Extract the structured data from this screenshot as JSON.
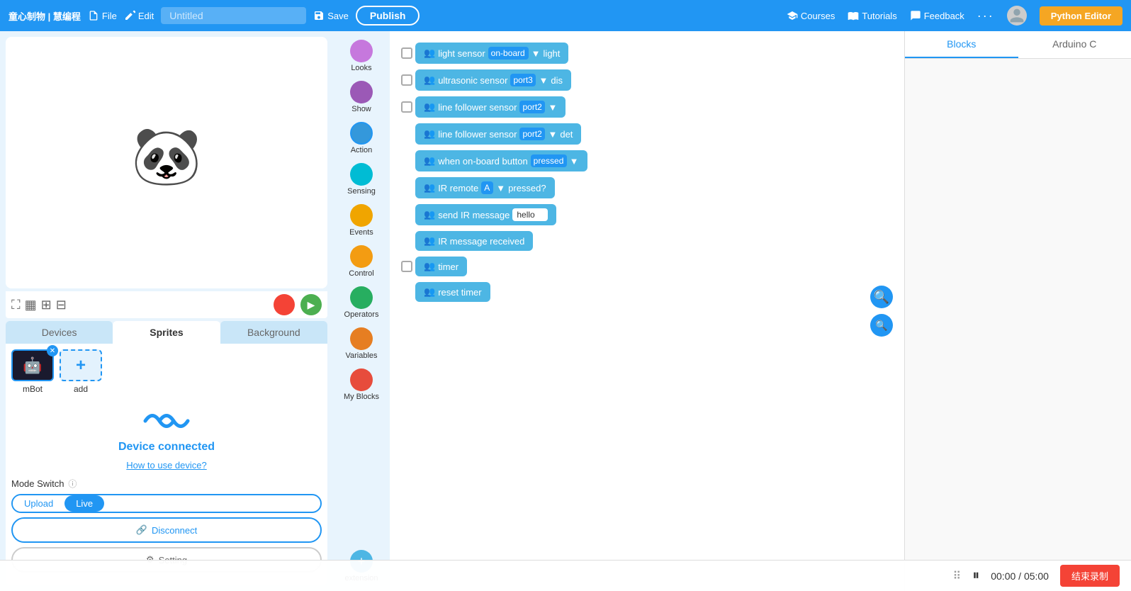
{
  "nav": {
    "logo": "童心制物 | 慧编程",
    "file_label": "File",
    "edit_label": "Edit",
    "title_placeholder": "Untitled",
    "save_label": "Save",
    "publish_label": "Publish",
    "courses_label": "Courses",
    "tutorials_label": "Tutorials",
    "feedback_label": "Feedback",
    "python_editor_label": "Python Editor",
    "more": "···"
  },
  "right_panel": {
    "tabs": [
      {
        "label": "Blocks",
        "active": true
      },
      {
        "label": "Arduino C",
        "active": false
      }
    ]
  },
  "panel_tabs": {
    "devices": "Devices",
    "sprites": "Sprites",
    "background": "Background"
  },
  "categories": [
    {
      "id": "looks",
      "label": "Looks",
      "color": "#c678dd"
    },
    {
      "id": "show",
      "label": "Show",
      "color": "#9b59b6"
    },
    {
      "id": "action",
      "label": "Action",
      "color": "#3498db",
      "active": true
    },
    {
      "id": "sensing",
      "label": "Sensing",
      "color": "#00bcd4"
    },
    {
      "id": "events",
      "label": "Events",
      "color": "#f0a500"
    },
    {
      "id": "control",
      "label": "Control",
      "color": "#f39c12"
    },
    {
      "id": "operators",
      "label": "Operators",
      "color": "#27ae60"
    },
    {
      "id": "variables",
      "label": "Variables",
      "color": "#e67e22"
    },
    {
      "id": "my_blocks",
      "label": "My Blocks",
      "color": "#e74c3c"
    }
  ],
  "blocks": [
    {
      "id": "light-sensor",
      "text": "light sensor",
      "extra1": "on-board",
      "extra2": "light",
      "has_checkbox": true
    },
    {
      "id": "ultrasonic-sensor",
      "text": "ultrasonic sensor",
      "extra1": "port3",
      "extra2": "dis",
      "has_checkbox": true
    },
    {
      "id": "line-follower-1",
      "text": "line follower sensor",
      "extra1": "port2",
      "extra2": "",
      "has_checkbox": true
    },
    {
      "id": "line-follower-2",
      "text": "line follower sensor",
      "extra1": "port2",
      "extra2": "det",
      "has_checkbox": false
    },
    {
      "id": "on-board-btn",
      "text": "when on-board button",
      "extra1": "pressed",
      "has_checkbox": false
    },
    {
      "id": "ir-remote",
      "text": "IR remote",
      "extra1": "A",
      "extra2": "pressed?",
      "has_checkbox": false
    },
    {
      "id": "send-ir",
      "text": "send IR message",
      "input": "hello",
      "has_checkbox": false
    },
    {
      "id": "ir-received",
      "text": "IR message received",
      "has_checkbox": false
    },
    {
      "id": "timer",
      "text": "timer",
      "has_checkbox": true
    },
    {
      "id": "reset-timer",
      "text": "reset timer",
      "has_checkbox": false
    }
  ],
  "device_panel": {
    "connected_text": "Device connected",
    "how_to": "How to use device?",
    "mode_label": "Mode Switch",
    "upload_label": "Upload",
    "live_label": "Live",
    "disconnect_label": "Disconnect",
    "setting_label": "Setting"
  },
  "bottom_bar": {
    "timer_text": "00:00 / 05:00",
    "end_label": "结束录制"
  }
}
